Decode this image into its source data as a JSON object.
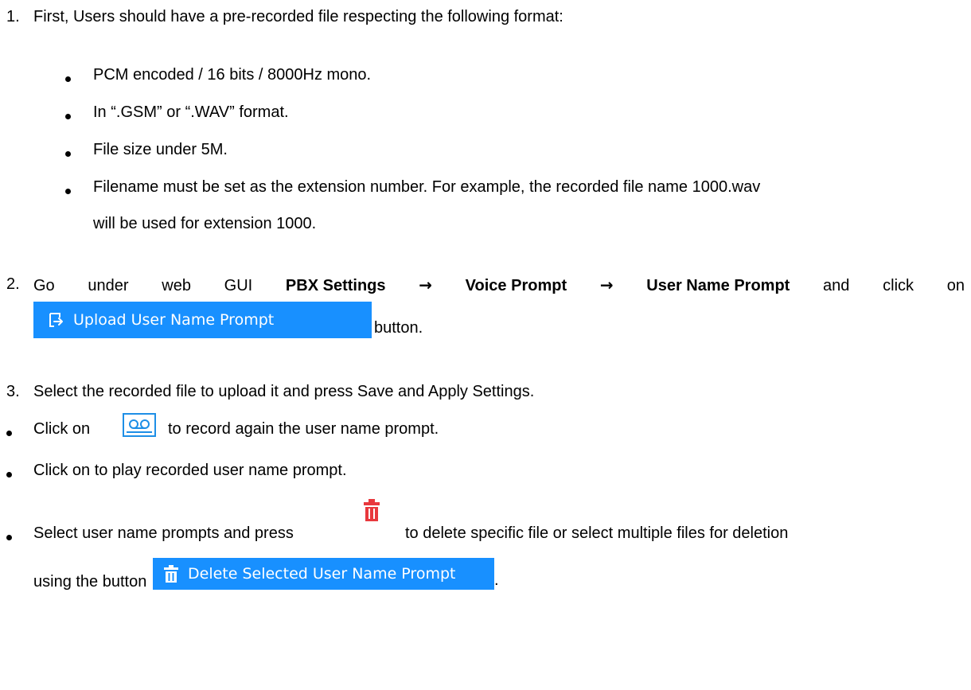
{
  "step1": {
    "number": "1.",
    "text": "First, Users should have a pre-recorded file respecting the following format:"
  },
  "format_items": [
    "PCM encoded / 16 bits / 8000Hz mono.",
    "In “.GSM” or “.WAV” format.",
    "File size under 5M.",
    "Filename must be set as the extension number. For example, the recorded file name 1000.wav",
    "will be used for extension 1000."
  ],
  "step2": {
    "number": "2.",
    "w1": "Go",
    "w2": "under",
    "w3": "web",
    "w4": "GUI",
    "path1": "PBX Settings",
    "arrow": "→",
    "path2": "Voice Prompt",
    "path3": "User Name Prompt",
    "w5": "and",
    "w6": "click",
    "w7": "on",
    "after_button": "button."
  },
  "upload_button": {
    "label": "Upload User Name Prompt",
    "icon": "upload-icon",
    "color": "#1890ff"
  },
  "step3": {
    "number": "3.",
    "text": "Select the recorded file to upload it and press Save and Apply Settings."
  },
  "bullet_record": {
    "before": "Click on",
    "icon": "record-icon",
    "after": "to record again the user name prompt."
  },
  "bullet_play": {
    "text": "Click on to play recorded user name prompt."
  },
  "bullet_delete": {
    "before": "Select user name prompts and press",
    "icon": "trash-icon",
    "after": "to delete specific file or select multiple files for deletion",
    "line2": "using the button",
    "end": "."
  },
  "delete_button": {
    "label": "Delete Selected User Name Prompt",
    "icon": "trash-icon",
    "color": "#1890ff"
  }
}
